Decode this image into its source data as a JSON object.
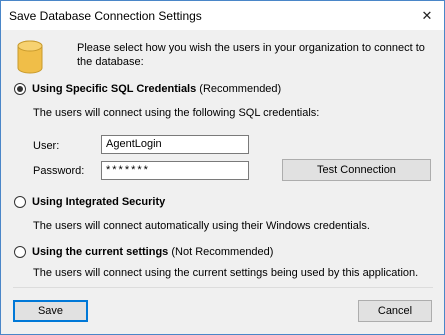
{
  "window": {
    "title": "Save Database Connection Settings",
    "close_glyph": "✕"
  },
  "intro": "Please select how you wish the users in your organization to connect to the database:",
  "options": {
    "specific": {
      "label_bold": "Using Specific SQL Credentials",
      "label_suffix": " (Recommended)",
      "desc": "The users will connect using the following SQL credentials:",
      "checked": true
    },
    "integrated": {
      "label_bold": "Using Integrated Security",
      "label_suffix": "",
      "desc": "The users will connect automatically using their Windows credentials.",
      "checked": false
    },
    "current": {
      "label_bold": "Using the current settings",
      "label_suffix": " (Not Recommended)",
      "desc": "The users will connect using the current settings being used by this application.",
      "checked": false
    }
  },
  "credentials": {
    "user_label": "User:",
    "user_value": "AgentLogin",
    "password_label": "Password:",
    "password_value": "*******"
  },
  "buttons": {
    "test": "Test Connection",
    "save": "Save",
    "cancel": "Cancel"
  },
  "icons": {
    "database": "database-icon",
    "close": "close-icon"
  }
}
